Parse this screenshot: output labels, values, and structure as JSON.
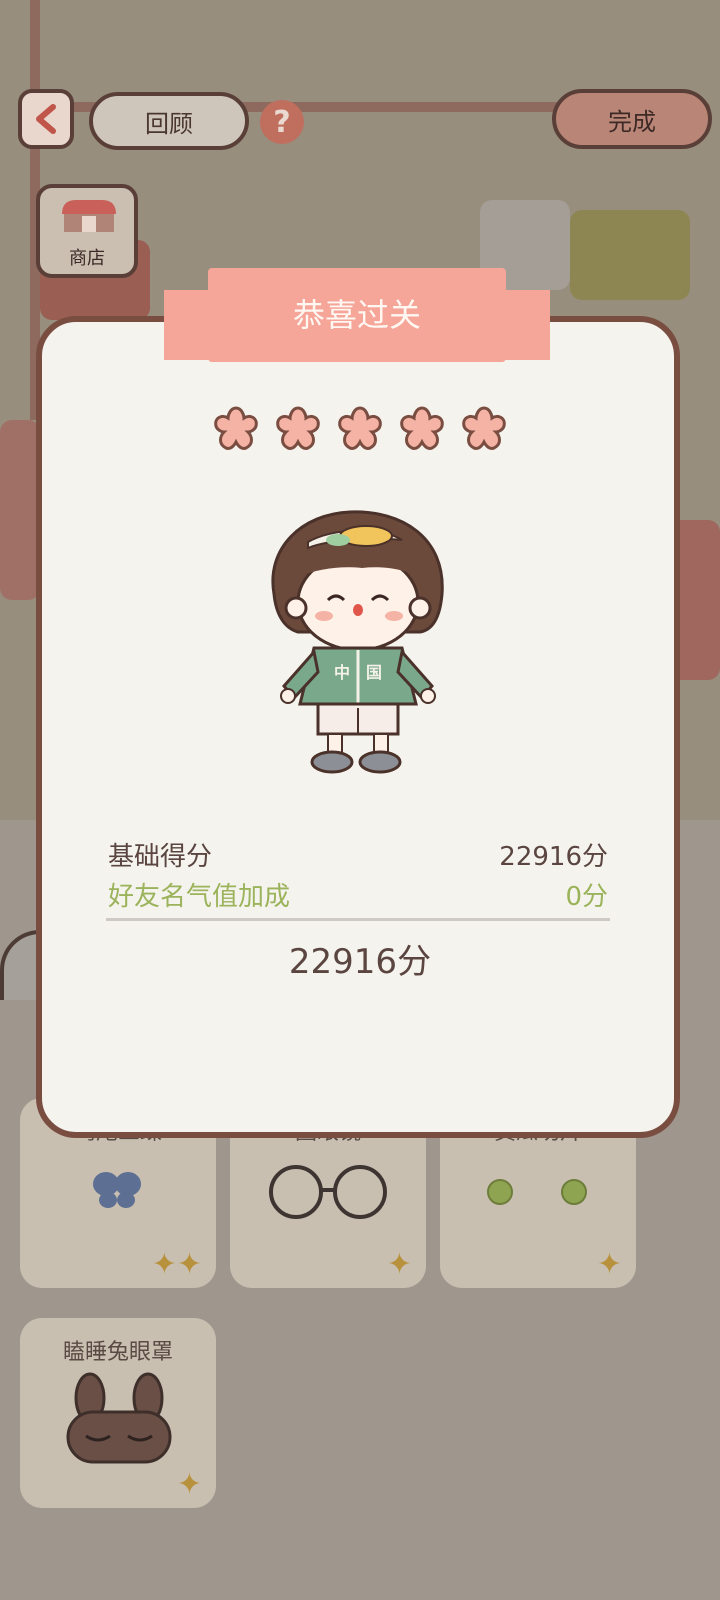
{
  "topbar": {
    "review_label": "回顾",
    "done_label": "完成",
    "shop_label": "商店"
  },
  "modal": {
    "title": "恭喜过关",
    "stars_filled": 5,
    "stars_total": 5,
    "base_score_label": "基础得分",
    "base_score_value": "22916分",
    "bonus_label": "好友名气值加成",
    "bonus_value": "0分",
    "total_value": "22916分"
  },
  "cards": [
    {
      "name": "鸢尾三蝶",
      "icon": "butterfly-icon"
    },
    {
      "name": "圆眼镜",
      "icon": "glasses-icon"
    },
    {
      "name": "黄瓜切片",
      "icon": "cucumber-icon"
    },
    {
      "name": "瞌睡兔眼罩",
      "icon": "bunny-eye-mask-icon"
    }
  ],
  "colors": {
    "modal_border": "#7a4d41",
    "ribbon": "#f5a698",
    "bonus_text": "#9bb35a",
    "star": "#f5b3a6"
  }
}
